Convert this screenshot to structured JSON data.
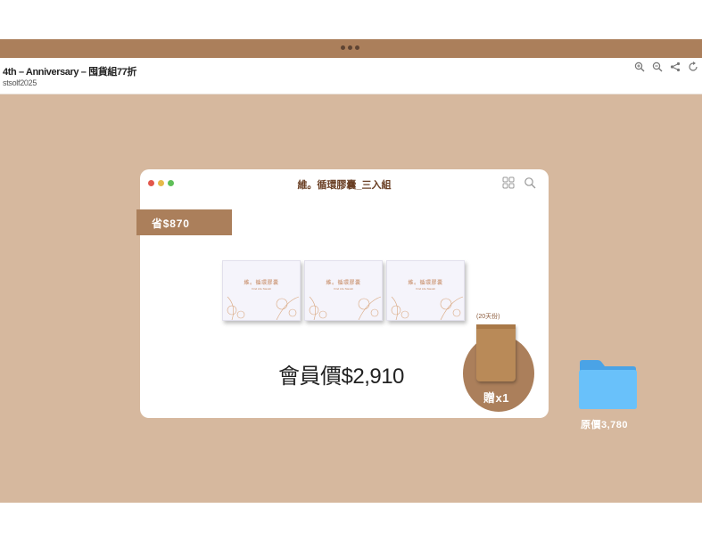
{
  "header": {
    "title": "4th – Anniversary – 囤貨組77折",
    "subtitle": "stsolf2025"
  },
  "toolbar_icons": [
    "zoom-in-icon",
    "zoom-out-icon",
    "share-icon",
    "refresh-icon"
  ],
  "window": {
    "title": "維。循環膠囊_三入組",
    "traffic_colors": [
      "#e2574c",
      "#e6b94a",
      "#5fbf58"
    ]
  },
  "promo": {
    "save_badge": "省$870",
    "box_name": "維。循環膠囊",
    "box_sub": "Find Life Stavalt",
    "member_price": "會員價$2,910",
    "gift_days": "(20天份)",
    "gift_label": "贈x1"
  },
  "folder": {
    "label": "原價3,780"
  },
  "colors": {
    "accent": "#ab7f5b",
    "canvas": "#d6b89e",
    "folder": "#5fb7f5"
  }
}
